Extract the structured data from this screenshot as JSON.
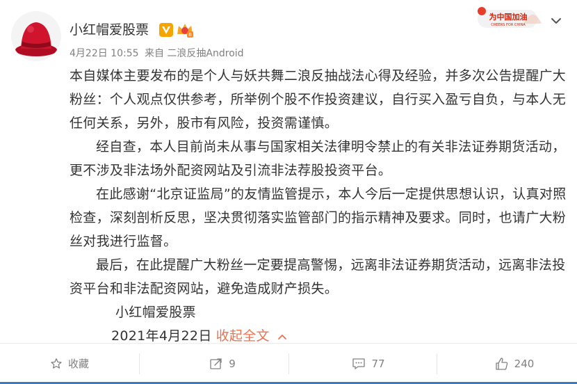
{
  "post": {
    "username": "小红帽爱股票",
    "meta_time": "4月22日 10:55",
    "meta_source": "来自 二浪反抽Android",
    "cheers_badge_text": "为中国加油",
    "cheers_badge_sub": "CHEERS FOR CHINA",
    "paragraphs": [
      "本自媒体主要发布的是个人与妖共舞二浪反抽战法心得及经验，并多次公告提醒广大粉丝：个人观点仅供参考，所举例个股不作投资建议，自行买入盈亏自负，与本人无任何关系，另外，股市有风险，投资需谨慎。",
      "经自查，本人目前尚未从事与国家相关法律明令禁止的有关非法证券期货活动，更不涉及非法场外配资网站及引流非法荐股投资平台。",
      "在此感谢“北京证监局”的友情监管提示，本人今后一定提供思想认识，认真对照检查，深刻剖析反思，坚决贯彻落实监管部门的指示精神及要求。同时，也请广大粉丝对我进行监督。",
      "最后，在此提醒广大粉丝一定要提高警惕，远离非法证券期货活动，远离非法投资平台和非法配资网站，避免造成财产损失。"
    ],
    "signature": "小红帽爱股票",
    "sign_date": "2021年4月22日",
    "collapse_label": "收起全文"
  },
  "toolbar": {
    "favorite_label": "收藏",
    "repost_count": "9",
    "comment_count": "77",
    "like_count": "240"
  },
  "colors": {
    "accent": "#eb7350",
    "text": "#333333",
    "muted": "#808080",
    "avatar_red": "#c8102e",
    "bottom_bar": "#3b7bbf"
  }
}
